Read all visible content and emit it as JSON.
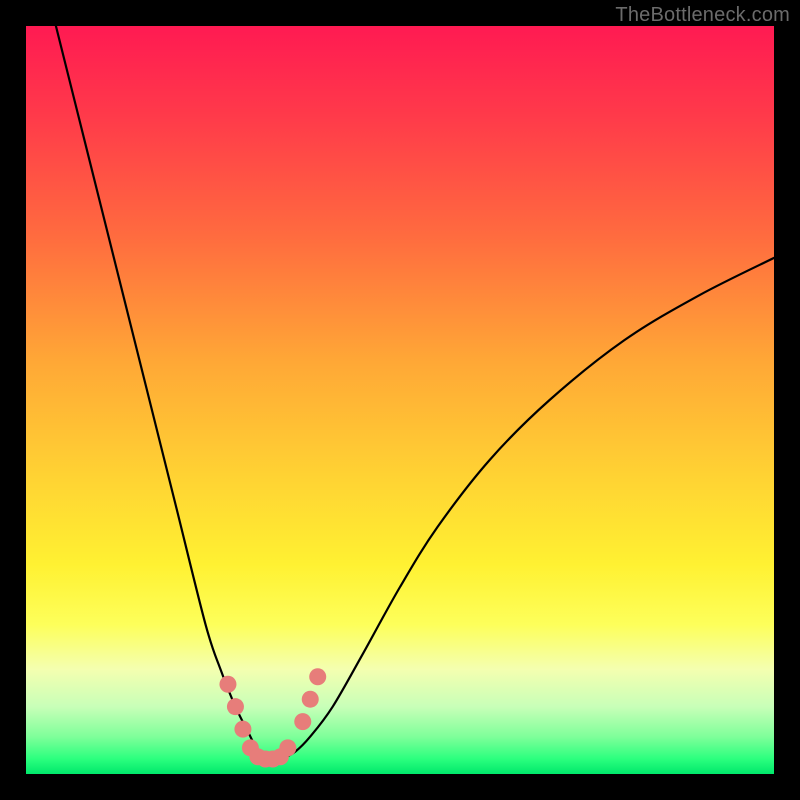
{
  "watermark": "TheBottleneck.com",
  "chart_data": {
    "type": "line",
    "title": "",
    "xlabel": "",
    "ylabel": "",
    "xlim": [
      0,
      100
    ],
    "ylim": [
      0,
      100
    ],
    "grid": false,
    "legend": false,
    "series": [
      {
        "name": "curve",
        "x": [
          4,
          8,
          12,
          16,
          20,
          24,
          26,
          28,
          30,
          31,
          32,
          33,
          34,
          36,
          38,
          41,
          45,
          50,
          55,
          62,
          70,
          80,
          90,
          100
        ],
        "y": [
          100,
          84,
          68,
          52,
          36,
          20,
          14,
          9,
          5,
          3,
          2,
          2,
          2,
          3,
          5,
          9,
          16,
          25,
          33,
          42,
          50,
          58,
          64,
          69
        ]
      }
    ],
    "markers": [
      {
        "x": 27,
        "y": 12
      },
      {
        "x": 28,
        "y": 9
      },
      {
        "x": 29,
        "y": 6
      },
      {
        "x": 30,
        "y": 3.5
      },
      {
        "x": 31,
        "y": 2.3
      },
      {
        "x": 32,
        "y": 2
      },
      {
        "x": 33,
        "y": 2
      },
      {
        "x": 34,
        "y": 2.3
      },
      {
        "x": 35,
        "y": 3.5
      },
      {
        "x": 37,
        "y": 7
      },
      {
        "x": 38,
        "y": 10
      },
      {
        "x": 39,
        "y": 13
      }
    ],
    "colors": {
      "gradient_top": "#ff1a52",
      "gradient_bottom": "#00e86b",
      "curve": "#000000",
      "markers": "#e77d7a"
    }
  }
}
